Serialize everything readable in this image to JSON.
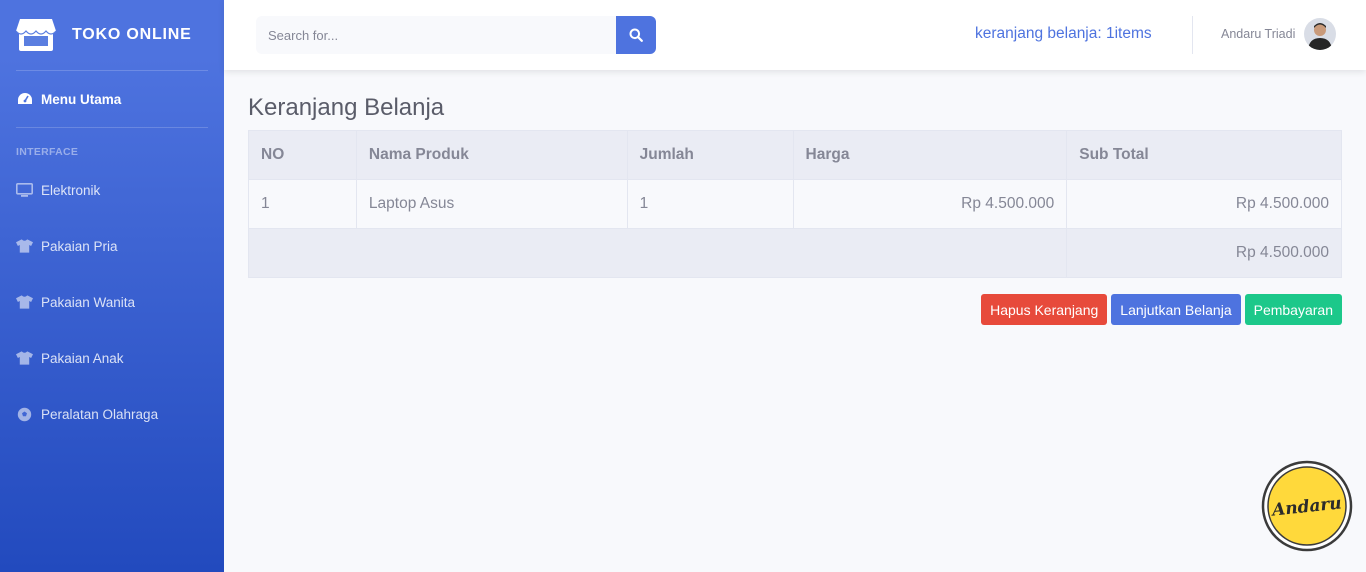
{
  "sidebar": {
    "brand": "TOKO ONLINE",
    "brand_icon": "store-icon",
    "dashboard": {
      "label": "Menu Utama",
      "icon": "tachometer-icon"
    },
    "heading": "INTERFACE",
    "items": [
      {
        "label": "Elektronik",
        "icon": "desktop-icon"
      },
      {
        "label": "Pakaian Pria",
        "icon": "tshirt-icon"
      },
      {
        "label": "Pakaian Wanita",
        "icon": "tshirt-icon"
      },
      {
        "label": "Pakaian Anak",
        "icon": "tshirt-icon"
      },
      {
        "label": "Peralatan Olahraga",
        "icon": "football-icon"
      }
    ]
  },
  "topbar": {
    "search_placeholder": "Search for...",
    "search_icon": "search-icon",
    "cart_label": "keranjang belanja: 1items",
    "user_name": "Andaru Triadi"
  },
  "main": {
    "title": "Keranjang Belanja",
    "table": {
      "headers": [
        "NO",
        "Nama Produk",
        "Jumlah",
        "Harga",
        "Sub Total"
      ],
      "rows": [
        {
          "no": "1",
          "product": "Laptop Asus",
          "qty": "1",
          "price": "Rp 4.500.000",
          "subtotal": "Rp 4.500.000"
        }
      ],
      "total": "Rp 4.500.000"
    },
    "buttons": {
      "clear": "Hapus Keranjang",
      "continue": "Lanjutkan Belanja",
      "checkout": "Pembayaran"
    }
  },
  "watermark": {
    "text": "Andaru"
  },
  "colors": {
    "primary": "#4e73df",
    "danger": "#e74a3b",
    "success": "#1cc88a",
    "watermark_fill": "#ffd93b"
  }
}
